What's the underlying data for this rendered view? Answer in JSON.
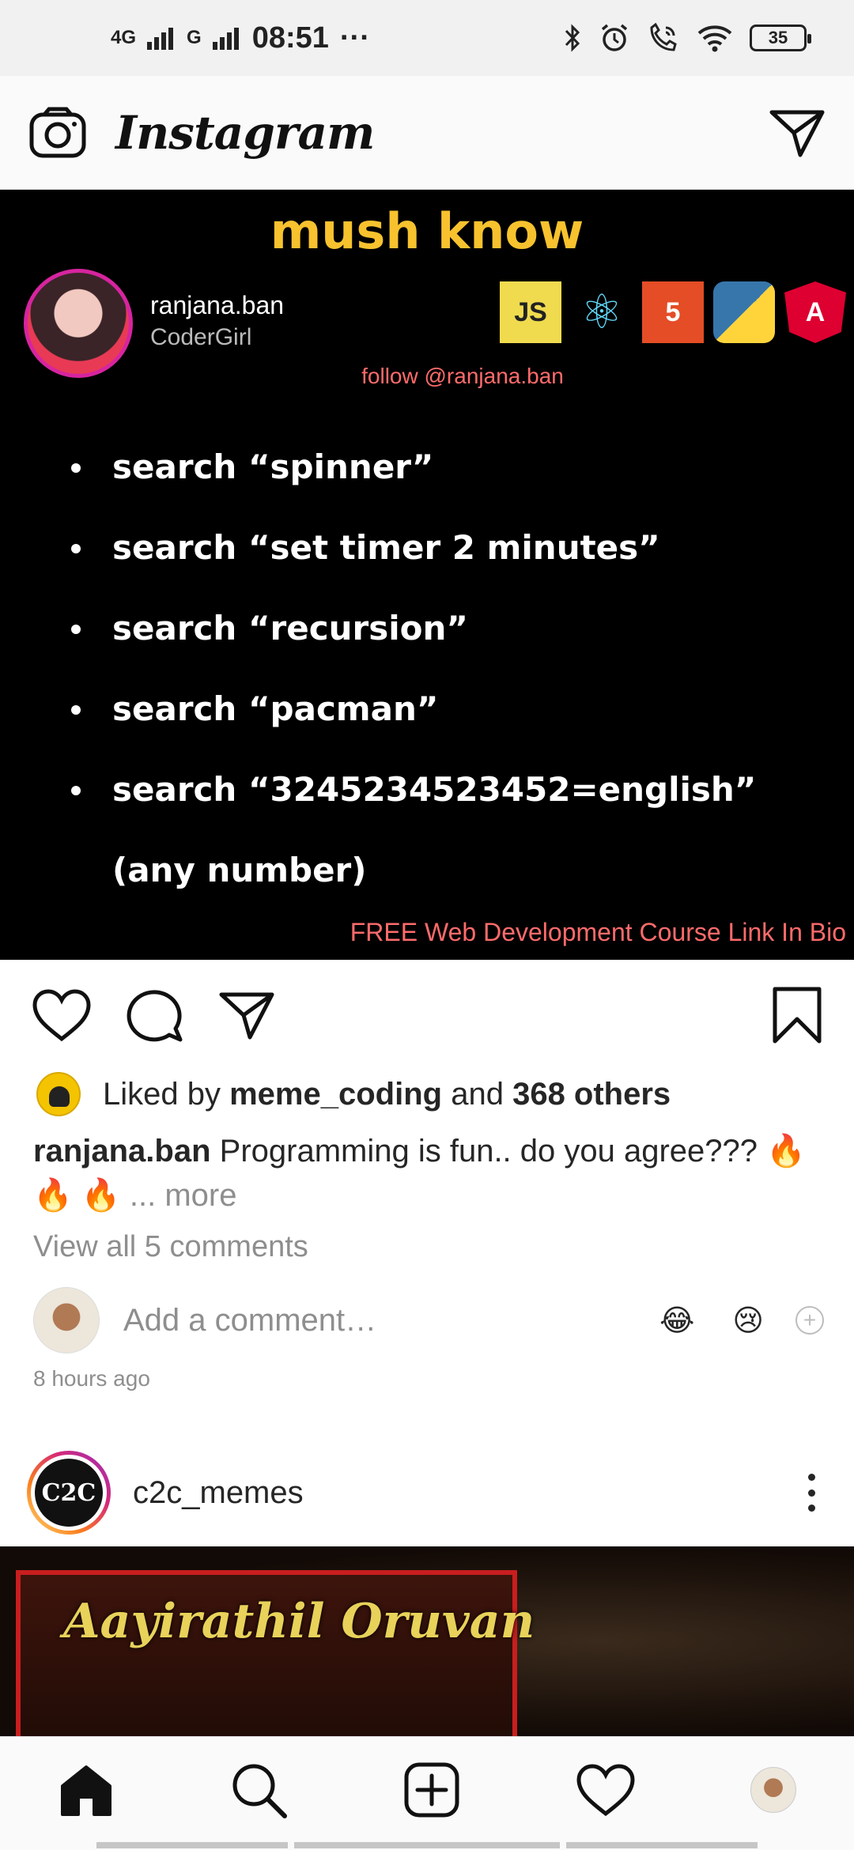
{
  "status_bar": {
    "sim1": "4G",
    "sim2": "G",
    "time": "08:51",
    "more": "···",
    "battery": "35"
  },
  "header": {
    "title": "Instagram"
  },
  "post1": {
    "image": {
      "headline": "mush know",
      "author_name": "ranjana.ban",
      "author_sub": "CoderGirl",
      "logo_js": "JS",
      "logo_html": "5",
      "logo_angular": "A",
      "follow_text": "follow @ranjana.ban",
      "tips": [
        "search “spinner”",
        "search “set timer 2 minutes”",
        "search “recursion”",
        "search “pacman”",
        "search “3245234523452=english” (any number)"
      ],
      "promo": "FREE Web Development Course Link In Bio"
    },
    "likes": {
      "prefix": "Liked by",
      "user": "meme_coding",
      "and": "and",
      "count": "368 others"
    },
    "caption": {
      "username": "ranjana.ban",
      "text": "Programming is fun.. do you agree??? 🔥 🔥 🔥",
      "more": "... more"
    },
    "view_comments": "View all 5 comments",
    "comment_placeholder": "Add a comment…",
    "quick_emojis": [
      "😂",
      "😢"
    ],
    "timestamp": "8 hours ago"
  },
  "post2": {
    "username": "c2c_memes",
    "logo_text": "C2C",
    "poster_title": "Aayirathil Oruvan"
  },
  "icons": {
    "camera": "camera-icon",
    "direct": "paper-plane-icon",
    "like": "heart-icon",
    "comment": "comment-icon",
    "share": "paper-plane-icon",
    "save": "bookmark-icon",
    "home": "home-icon",
    "search": "search-icon",
    "new_post": "plus-square-icon",
    "activity": "heart-icon"
  },
  "colors": {
    "headline": "#f7c22e",
    "promo": "#ff6b6b",
    "secondary_text": "#8e8e8e"
  }
}
